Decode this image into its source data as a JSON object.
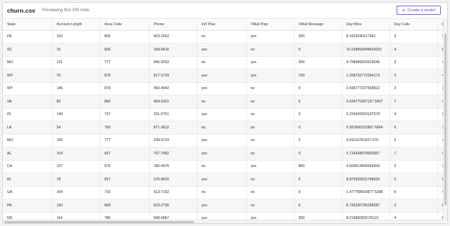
{
  "header": {
    "title": "churn.csv",
    "subtitle": "Previewing first 100 rows",
    "create_label": "Create a model"
  },
  "columns": [
    "State",
    "Account Length",
    "Area Code",
    "Phone",
    "Int'l Plan",
    "VMail Plan",
    "VMail Message",
    "Day Mins",
    "Day Calls",
    "Da"
  ],
  "rows": [
    [
      "PA",
      "163",
      "806",
      "403-2562",
      "no",
      "yes",
      "300",
      "8.1622040217381",
      "3",
      "7"
    ],
    [
      "SC",
      "15",
      "836",
      "158-8416",
      "yes",
      "no",
      "0",
      "10.018992848434252",
      "4",
      "8"
    ],
    [
      "MO",
      "131",
      "777",
      "896-6253",
      "no",
      "yes",
      "300",
      "4.708489916519045",
      "3",
      "4"
    ],
    [
      "WY",
      "75",
      "878",
      "817-5729",
      "yes",
      "yes",
      "700",
      "1.268733772354173",
      "3",
      "4"
    ],
    [
      "WY",
      "146",
      "878",
      "450-4942",
      "yes",
      "no",
      "0",
      "2.696777237538812",
      "3",
      "3"
    ],
    [
      "VA",
      "83",
      "866",
      "454-9110",
      "no",
      "no",
      "0",
      "3.634775387157 5437",
      "7",
      "4"
    ],
    [
      "IN",
      "140",
      "737",
      "331-5751",
      "yes",
      "no",
      "0",
      "3.229420559197578",
      "4",
      "2"
    ],
    [
      "LA",
      "54",
      "766",
      "871-3612",
      "no",
      "no",
      "0",
      "0.567600162867 6664",
      "6",
      "1"
    ],
    [
      "MO",
      "195",
      "777",
      "249-5723",
      "yes",
      "no",
      "0",
      "5.81110761837 079",
      "6",
      "4"
    ],
    [
      "AL",
      "104",
      "657",
      "767-7682",
      "yes",
      "no",
      "0",
      "2.714428979003967",
      "7",
      "4"
    ],
    [
      "CA",
      "137",
      "676",
      "185-4976",
      "no",
      "yes",
      "800",
      "3.609014606643843",
      "3",
      "3"
    ],
    [
      "RI",
      "78",
      "827",
      "276-8625",
      "yes",
      "no",
      "0",
      "8.879393631798926",
      "2",
      "6"
    ],
    [
      "GA",
      "164",
      "716",
      "613-7162",
      "no",
      "no",
      "0",
      "1.477758590877 5288",
      "6",
      "4"
    ],
    [
      "PA",
      "150",
      "808",
      "610-2736",
      "yes",
      "no",
      "0",
      "8.735230795298287",
      "3",
      "6"
    ],
    [
      "ND",
      "114",
      "786",
      "968-6867",
      "yes",
      "yes",
      "300",
      "8.215860909 05121",
      "4",
      "6"
    ]
  ]
}
